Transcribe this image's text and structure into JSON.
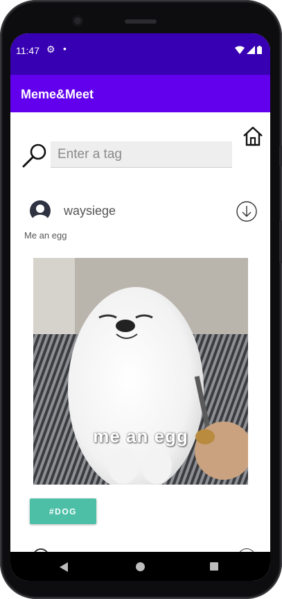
{
  "status_bar": {
    "time": "11:47",
    "settings_icon": "gear-icon",
    "notification_icon": "dot-icon",
    "wifi_icon": "wifi-icon",
    "signal_icon": "signal-icon",
    "battery_icon": "battery-icon"
  },
  "app_bar": {
    "title": "Meme&Meet"
  },
  "home_button": {
    "icon": "home-icon"
  },
  "search": {
    "icon": "search-icon",
    "placeholder": "Enter a tag",
    "value": ""
  },
  "post": {
    "username": "waysiege",
    "avatar_icon": "avatar-icon",
    "download_icon": "download-icon",
    "caption": "Me an egg",
    "image_text": "me an egg",
    "tag_label": "#DOG"
  },
  "nav_bar": {
    "back_icon": "back-icon",
    "home_icon": "home-circle-icon",
    "recents_icon": "recents-icon"
  },
  "colors": {
    "status_bar": "#3700b3",
    "app_bar": "#6200ee",
    "tag_button": "#4dbfa7"
  }
}
